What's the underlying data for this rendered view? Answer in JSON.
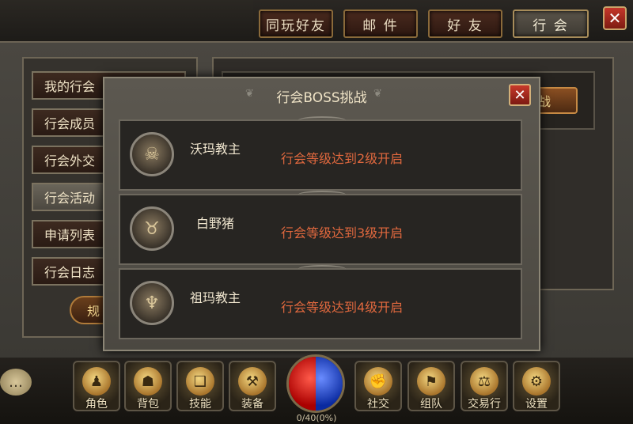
{
  "tabs": [
    {
      "label": "同玩好友",
      "active": false
    },
    {
      "label": "邮 件",
      "active": false
    },
    {
      "label": "好 友",
      "active": false
    },
    {
      "label": "行 会",
      "active": true
    }
  ],
  "close_label": "✕",
  "sidebar": {
    "items": [
      {
        "label": "我的行会"
      },
      {
        "label": "行会成员"
      },
      {
        "label": "行会外交"
      },
      {
        "label": "行会活动"
      },
      {
        "label": "申请列表"
      },
      {
        "label": "行会日志"
      }
    ],
    "rules_label": "规"
  },
  "right_panel": {
    "challenge_label": "战"
  },
  "modal": {
    "title": "行会BOSS挑战",
    "close_label": "✕",
    "bosses": [
      {
        "name": "沃玛教主",
        "requirement": "行会等级达到2级开启"
      },
      {
        "name": "白野猪",
        "requirement": "行会等级达到3级开启"
      },
      {
        "name": "祖玛教主",
        "requirement": "行会等级达到4级开启"
      }
    ]
  },
  "bottom_bar": {
    "buttons": [
      {
        "label": "角色",
        "icon": "character-icon"
      },
      {
        "label": "背包",
        "icon": "bag-icon"
      },
      {
        "label": "技能",
        "icon": "skill-book-icon"
      },
      {
        "label": "装备",
        "icon": "equipment-icon"
      },
      {
        "label": "社交",
        "icon": "social-icon"
      },
      {
        "label": "组队",
        "icon": "team-icon"
      },
      {
        "label": "交易行",
        "icon": "trade-icon"
      },
      {
        "label": "设置",
        "icon": "gear-icon"
      }
    ],
    "exp_text": "0/40(0%)",
    "exp_fraction": 0
  },
  "colors": {
    "accent_red": "#e0683e",
    "close_red": "#c8392b",
    "frame_gold": "#c9a46a"
  }
}
